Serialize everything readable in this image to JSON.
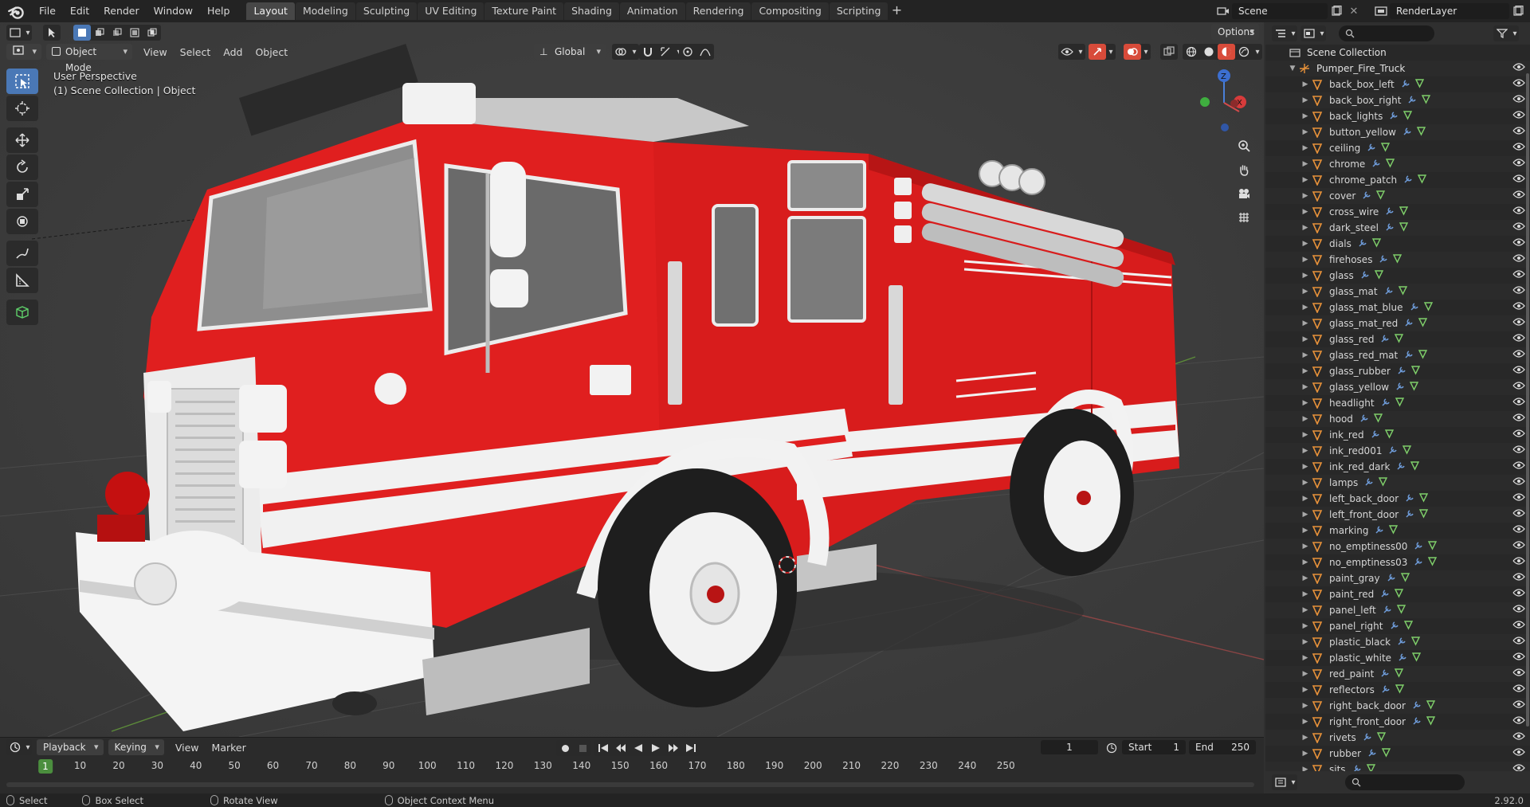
{
  "app": {
    "menus": [
      "File",
      "Edit",
      "Render",
      "Window",
      "Help"
    ],
    "workspaces": [
      "Layout",
      "Modeling",
      "Sculpting",
      "UV Editing",
      "Texture Paint",
      "Shading",
      "Animation",
      "Rendering",
      "Compositing",
      "Scripting"
    ],
    "active_workspace": "Layout",
    "scene": "Scene",
    "view_layer": "RenderLayer"
  },
  "viewport": {
    "mode": "Object Mode",
    "menus": [
      "View",
      "Select",
      "Add",
      "Object"
    ],
    "orientation": "Global",
    "options_label": "Options",
    "view_name": "User Perspective",
    "collection_info": "(1) Scene Collection | Object",
    "gizmo_axes": {
      "z": "Z",
      "x": "X"
    }
  },
  "outliner": {
    "root": "Scene Collection",
    "collection": "Pumper_Fire_Truck",
    "objects": [
      {
        "name": "back_box_left"
      },
      {
        "name": "back_box_right"
      },
      {
        "name": "back_lights"
      },
      {
        "name": "button_yellow"
      },
      {
        "name": "ceiling"
      },
      {
        "name": "chrome"
      },
      {
        "name": "chrome_patch"
      },
      {
        "name": "cover"
      },
      {
        "name": "cross_wire"
      },
      {
        "name": "dark_steel"
      },
      {
        "name": "dials"
      },
      {
        "name": "firehoses"
      },
      {
        "name": "glass"
      },
      {
        "name": "glass_mat"
      },
      {
        "name": "glass_mat_blue"
      },
      {
        "name": "glass_mat_red"
      },
      {
        "name": "glass_red"
      },
      {
        "name": "glass_red_mat"
      },
      {
        "name": "glass_rubber"
      },
      {
        "name": "glass_yellow"
      },
      {
        "name": "headlight"
      },
      {
        "name": "hood"
      },
      {
        "name": "ink_red"
      },
      {
        "name": "ink_red001"
      },
      {
        "name": "ink_red_dark"
      },
      {
        "name": "lamps"
      },
      {
        "name": "left_back_door"
      },
      {
        "name": "left_front_door"
      },
      {
        "name": "marking"
      },
      {
        "name": "no_emptiness00"
      },
      {
        "name": "no_emptiness03"
      },
      {
        "name": "paint_gray"
      },
      {
        "name": "paint_red"
      },
      {
        "name": "panel_left"
      },
      {
        "name": "panel_right"
      },
      {
        "name": "plastic_black"
      },
      {
        "name": "plastic_white"
      },
      {
        "name": "red_paint"
      },
      {
        "name": "reflectors"
      },
      {
        "name": "right_back_door"
      },
      {
        "name": "right_front_door"
      },
      {
        "name": "rivets"
      },
      {
        "name": "rubber"
      },
      {
        "name": "sits"
      }
    ]
  },
  "timeline": {
    "menus": [
      "Playback",
      "Keying",
      "View",
      "Marker"
    ],
    "current_frame": "1",
    "start_label": "Start",
    "start": "1",
    "end_label": "End",
    "end": "250",
    "ticks": [
      "10",
      "20",
      "30",
      "40",
      "50",
      "60",
      "70",
      "80",
      "90",
      "100",
      "110",
      "120",
      "130",
      "140",
      "150",
      "160",
      "170",
      "180",
      "190",
      "200",
      "210",
      "220",
      "230",
      "240",
      "250"
    ],
    "playhead": "1"
  },
  "statusbar": {
    "select": "Select",
    "box_select": "Box Select",
    "rotate_view": "Rotate View",
    "context_menu": "Object Context Menu",
    "version": "2.92.0"
  },
  "colors": {
    "accent_blue": "#4a78b6",
    "truck_red": "#e01f1f",
    "object_icon_orange": "#e8923a",
    "playhead_green": "#4b8e3e"
  }
}
